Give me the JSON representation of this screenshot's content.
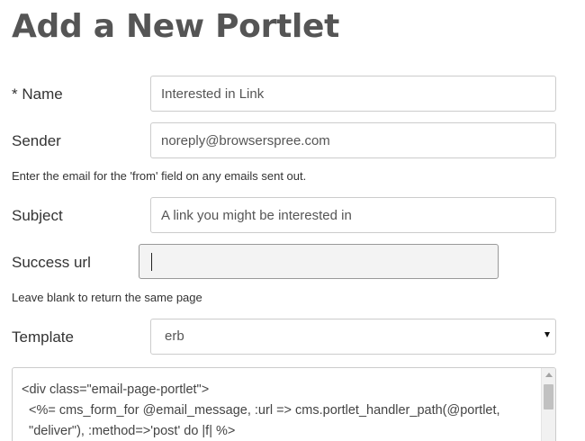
{
  "page": {
    "title": "Add a New Portlet"
  },
  "form": {
    "name": {
      "label": "* Name",
      "value": "Interested in Link"
    },
    "sender": {
      "label": "Sender",
      "value": "noreply@browserspree.com",
      "help": "Enter the email for the 'from' field on any emails sent out."
    },
    "subject": {
      "label": "Subject",
      "value": "A link you might be interested in"
    },
    "success_url": {
      "label": "Success url",
      "value": "",
      "help": "Leave blank to return the same page"
    },
    "template": {
      "label": "Template",
      "selected": "erb"
    },
    "code": {
      "lines": [
        "<div class=\"email-page-portlet\">",
        "  <%= cms_form_for @email_message, :url => cms.portlet_handler_path(@portlet,",
        "  \"deliver\"), :method=>'post' do |f| %>"
      ]
    }
  },
  "icons": {
    "select_arrow": "chevron-down-icon",
    "scroll_up": "scroll-up-arrow-icon"
  },
  "colors": {
    "title": "#555555",
    "text": "#333333",
    "border": "#cccccc",
    "focused_background": "#f3f3f3"
  }
}
